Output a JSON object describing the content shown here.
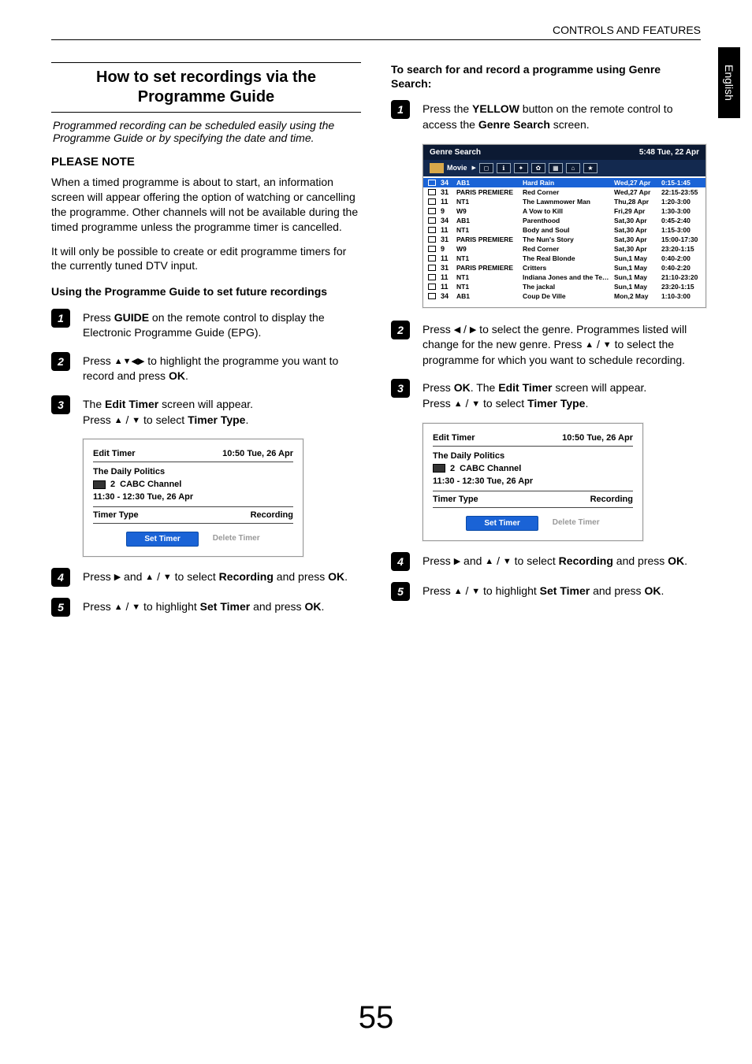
{
  "header": "CONTROLS AND FEATURES",
  "tab": "English",
  "page_number": "55",
  "left": {
    "main_heading": "How to set recordings via the Programme Guide",
    "intro": "Programmed recording can be scheduled easily using the Programme Guide or by specifying the date and time.",
    "note_heading": "PLEASE NOTE",
    "note_para1": "When a timed programme is about to start, an information screen will appear offering the option of watching or cancelling the programme. Other channels will not be available during the timed programme unless the programme timer is cancelled.",
    "note_para2": "It will only be possible to create or edit programme timers for the currently tuned DTV input.",
    "use_heading": "Using the Programme Guide to set future recordings",
    "steps": {
      "s1_pre": "Press ",
      "s1_bold": "GUIDE",
      "s1_post": " on the remote control to display the Electronic Programme Guide (EPG).",
      "s2_pre": "Press ",
      "s2_post": " to highlight the programme you want to record and press ",
      "s2_bold2": "OK",
      "s2_end": ".",
      "s3_pre": "The ",
      "s3_bold": "Edit Timer",
      "s3_mid": " screen will appear.",
      "s3_line2_pre": "Press ",
      "s3_line2_mid": " to select ",
      "s3_line2_bold": "Timer Type",
      "s3_line2_end": ".",
      "s4_pre": "Press ",
      "s4_mid": " and ",
      "s4_mid2": " to select ",
      "s4_bold": "Recording",
      "s4_post": " and press ",
      "s4_bold2": "OK",
      "s4_end": ".",
      "s5_pre": "Press ",
      "s5_mid": " to highlight ",
      "s5_bold": "Set Timer",
      "s5_post": " and press ",
      "s5_bold2": "OK",
      "s5_end": "."
    },
    "panel": {
      "title": "Edit Timer",
      "datetime": "10:50 Tue, 26 Apr",
      "prog": "The Daily Politics",
      "ch_no": "2",
      "ch_name": "CABC  Channel",
      "time": "11:30 - 12:30 Tue, 26 Apr",
      "tt_label": "Timer Type",
      "tt_val": "Recording",
      "set": "Set Timer",
      "del": "Delete Timer"
    }
  },
  "right": {
    "use_heading": "To search for and record a programme using Genre Search:",
    "s1_pre": "Press the ",
    "s1_bold": "YELLOW",
    "s1_mid": " button on the remote control to access the ",
    "s1_bold2": "Genre Search",
    "s1_end": " screen.",
    "genre_panel": {
      "title": "Genre Search",
      "datetime": "5:48 Tue, 22 Apr",
      "cat_label": "Movie",
      "rows": [
        {
          "no": "34",
          "ch": "AB1",
          "title": "Hard Rain",
          "date": "Wed,27 Apr",
          "time": "0:15-1:45",
          "sel": true
        },
        {
          "no": "31",
          "ch": "PARIS PREMIERE",
          "title": "Red Corner",
          "date": "Wed,27 Apr",
          "time": "22:15-23:55"
        },
        {
          "no": "11",
          "ch": "NT1",
          "title": "The Lawnmower Man",
          "date": "Thu,28 Apr",
          "time": "1:20-3:00"
        },
        {
          "no": "9",
          "ch": "W9",
          "title": "A Vow to Kill",
          "date": "Fri,29 Apr",
          "time": "1:30-3:00"
        },
        {
          "no": "34",
          "ch": "AB1",
          "title": "Parenthood",
          "date": "Sat,30 Apr",
          "time": "0:45-2:40"
        },
        {
          "no": "11",
          "ch": "NT1",
          "title": "Body and Soul",
          "date": "Sat,30 Apr",
          "time": "1:15-3:00"
        },
        {
          "no": "31",
          "ch": "PARIS PREMIERE",
          "title": "The Nun's Story",
          "date": "Sat,30 Apr",
          "time": "15:00-17:30"
        },
        {
          "no": "9",
          "ch": "W9",
          "title": "Red Corner",
          "date": "Sat,30 Apr",
          "time": "23:20-1:15"
        },
        {
          "no": "11",
          "ch": "NT1",
          "title": "The Real Blonde",
          "date": "Sun,1 May",
          "time": "0:40-2:00"
        },
        {
          "no": "31",
          "ch": "PARIS PREMIERE",
          "title": "Critters",
          "date": "Sun,1 May",
          "time": "0:40-2:20"
        },
        {
          "no": "11",
          "ch": "NT1",
          "title": "Indiana Jones and the Temple of Doom",
          "date": "Sun,1 May",
          "time": "21:10-23:20"
        },
        {
          "no": "11",
          "ch": "NT1",
          "title": "The jackal",
          "date": "Sun,1 May",
          "time": "23:20-1:15"
        },
        {
          "no": "34",
          "ch": "AB1",
          "title": "Coup De Ville",
          "date": "Mon,2 May",
          "time": "1:10-3:00"
        }
      ]
    },
    "s2_pre": "Press ",
    "s2_mid1": " to select the genre. Programmes listed will change for the new genre. Press ",
    "s2_mid2": " to select the programme for which you want to schedule recording.",
    "s3_pre": "Press ",
    "s3_bold": "OK",
    "s3_mid": ". The ",
    "s3_bold2": "Edit Timer",
    "s3_mid2": " screen will appear.",
    "s3_line2_pre": "Press ",
    "s3_line2_mid": " to select ",
    "s3_line2_bold": "Timer Type",
    "s3_line2_end": ".",
    "s4_pre": "Press ",
    "s4_mid": " and ",
    "s4_mid2": " to select ",
    "s4_bold": "Recording",
    "s4_post": " and press ",
    "s4_bold2": "OK",
    "s4_end": ".",
    "s5_pre": "Press ",
    "s5_mid": " to highlight ",
    "s5_bold": "Set Timer",
    "s5_post": " and press ",
    "s5_bold2": "OK",
    "s5_end": "."
  }
}
